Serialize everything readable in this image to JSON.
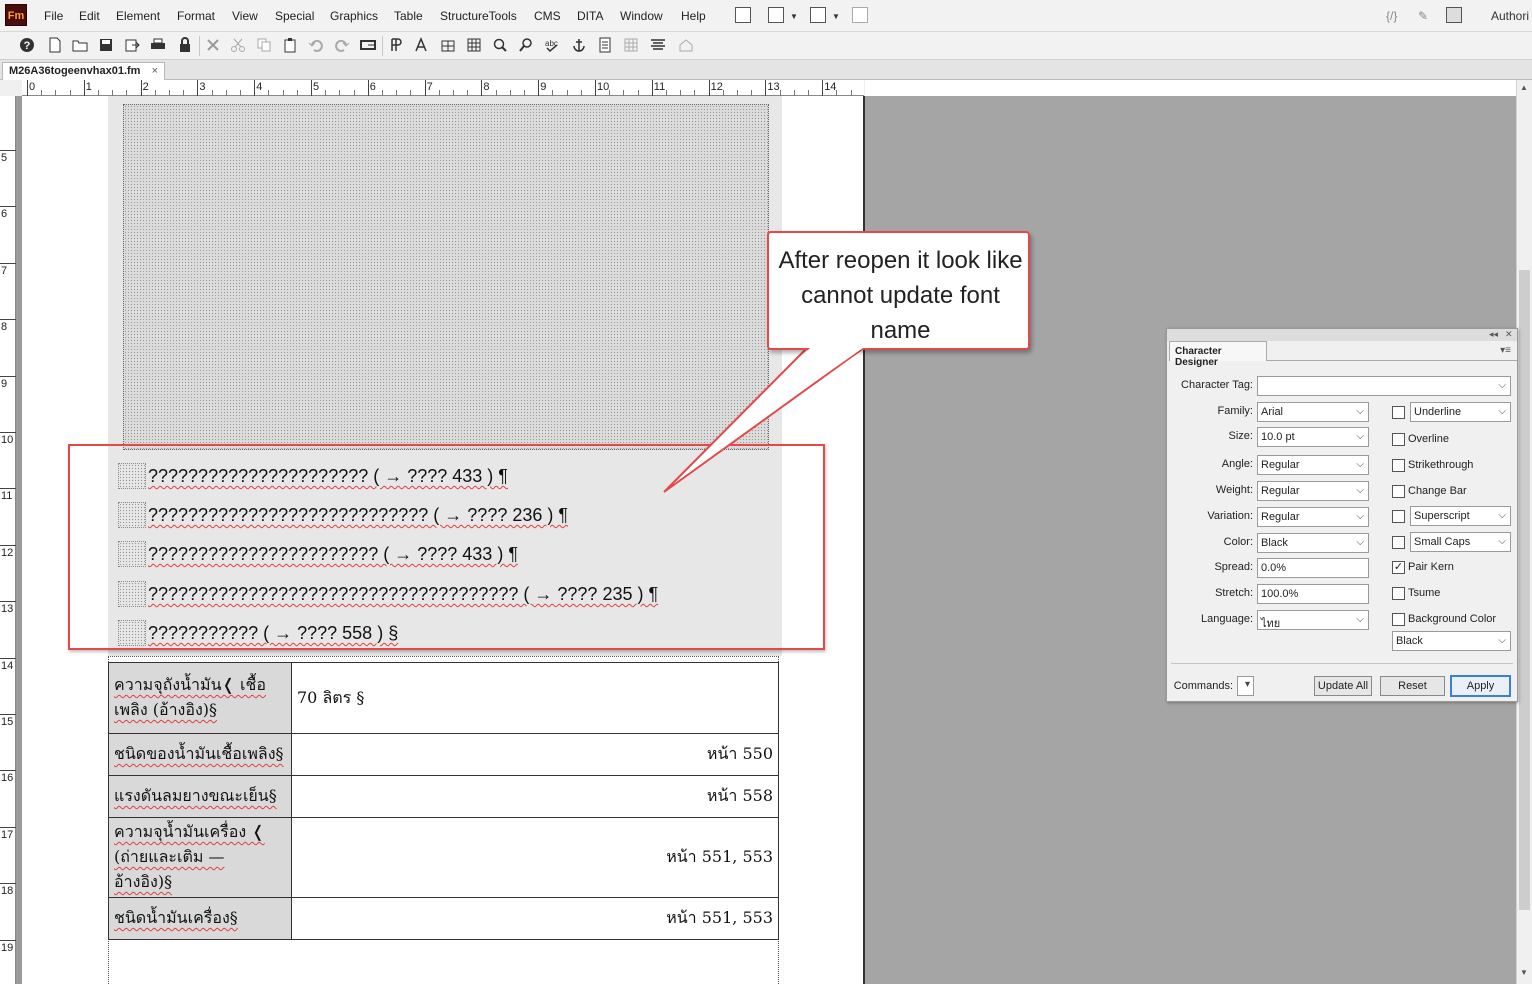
{
  "app": {
    "logo": "Fm",
    "author_label": "Authori"
  },
  "menus": [
    "File",
    "Edit",
    "Element",
    "Format",
    "View",
    "Special",
    "Graphics",
    "Table",
    "StructureTools",
    "CMS",
    "DITA",
    "Window",
    "Help"
  ],
  "document": {
    "tab_title": "M26A36togeenvhax01.fm",
    "close_glyph": "×"
  },
  "ruler": {
    "h_numbers": [
      "0",
      "1",
      "2",
      "3",
      "4",
      "5",
      "6",
      "7",
      "8",
      "9",
      "10",
      "11",
      "12",
      "13",
      "14"
    ],
    "v_numbers": [
      "5",
      "6",
      "7",
      "8",
      "9",
      "10",
      "11",
      "12",
      "13",
      "14",
      "15",
      "16",
      "17",
      "18",
      "19"
    ]
  },
  "lines": [
    {
      "text": "?????????????????????? ( → ???? 433 )  ¶"
    },
    {
      "text": "???????????????????????????? ( → ???? 236 )  ¶"
    },
    {
      "text": "??????????????????????? ( → ???? 433 )  ¶"
    },
    {
      "text": "????????????????????????????????????? ( → ???? 235 )  ¶"
    },
    {
      "text": "??????????? ( → ???? 558 )  §"
    }
  ],
  "callout": {
    "text": "After reopen it look like cannot update font name"
  },
  "table": {
    "rows": [
      {
        "label": "ความจุถังน้ำมัน❬ เชื้อเพลิง (อ้างอิง)§",
        "value": "70 ลิตร §",
        "align": "left"
      },
      {
        "label": "ชนิดของน้ำมันเชื้อเพลิง§",
        "value": "หน้า 550",
        "align": "right"
      },
      {
        "label": "แรงดันลมยางขณะเย็น§",
        "value": "หน้า 558",
        "align": "right"
      },
      {
        "label": "ความจุน้ำมันเครื่อง ❬ (ถ่ายและเติม — อ้างอิง)§",
        "value": "หน้า 551, 553",
        "align": "right"
      },
      {
        "label": "ชนิดน้ำมันเครื่อง§",
        "value": "หน้า 551, 553",
        "align": "right"
      }
    ]
  },
  "character_designer": {
    "title": "Character Designer",
    "labels": {
      "tag": "Character Tag:",
      "family": "Family:",
      "size": "Size:",
      "angle": "Angle:",
      "weight": "Weight:",
      "variation": "Variation:",
      "color": "Color:",
      "spread": "Spread:",
      "stretch": "Stretch:",
      "language": "Language:",
      "commands": "Commands:"
    },
    "values": {
      "tag": "",
      "family": "Arial",
      "size": "10.0 pt",
      "angle": "Regular",
      "weight": "Regular",
      "variation": "Regular",
      "color": "Black",
      "spread": "0.0%",
      "stretch": "100.0%",
      "language": "ไทย"
    },
    "checks": {
      "underline": {
        "label": "Underline",
        "checked": false
      },
      "overline": {
        "label": "Overline",
        "checked": false
      },
      "strikethrough": {
        "label": "Strikethrough",
        "checked": false
      },
      "change_bar": {
        "label": "Change Bar",
        "checked": false
      },
      "superscript": {
        "label": "Superscript",
        "checked": false
      },
      "small_caps": {
        "label": "Small Caps",
        "checked": false
      },
      "pair_kern": {
        "label": "Pair Kern",
        "checked": true
      },
      "tsume": {
        "label": "Tsume",
        "checked": false
      },
      "background_color": {
        "label": "Background Color",
        "checked": false
      }
    },
    "bg_color_value": "Black",
    "buttons": {
      "update_all": "Update All",
      "reset": "Reset",
      "apply": "Apply"
    }
  },
  "colors": {
    "annotation_red": "#e24a4a",
    "apply_border": "#3c7fd4"
  }
}
